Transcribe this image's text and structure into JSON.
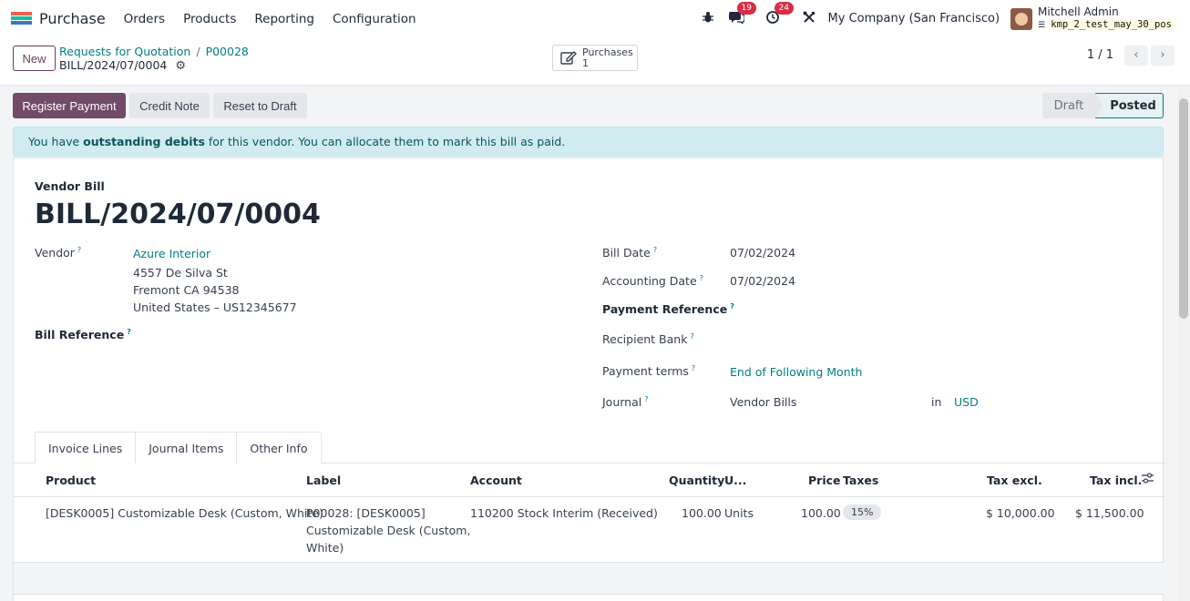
{
  "navbar": {
    "app_name": "Purchase",
    "menu": [
      "Orders",
      "Products",
      "Reporting",
      "Configuration"
    ],
    "messages_count": "19",
    "activities_count": "24",
    "company": "My Company (San Francisco)",
    "user_name": "Mitchell Admin",
    "db_name": "kmp_2_test_may_30_pos"
  },
  "control_panel": {
    "new_label": "New",
    "breadcrumb": [
      "Requests for Quotation",
      "P00028"
    ],
    "record_name": "BILL/2024/07/0004",
    "smart_button_label": "Purchases",
    "smart_button_count": "1",
    "pager": "1 / 1"
  },
  "actions": {
    "register_payment": "Register Payment",
    "credit_note": "Credit Note",
    "reset_to_draft": "Reset to Draft"
  },
  "status": {
    "draft": "Draft",
    "posted": "Posted",
    "active": "Posted"
  },
  "alert": {
    "prefix": "You have ",
    "bold": "outstanding debits",
    "suffix": " for this vendor. You can allocate them to mark this bill as paid."
  },
  "form": {
    "doc_type": "Vendor Bill",
    "doc_name": "BILL/2024/07/0004",
    "vendor_label": "Vendor",
    "vendor_name": "Azure Interior",
    "vendor_address": [
      "4557 De Silva St",
      "Fremont CA 94538",
      "United States – US12345677"
    ],
    "bill_reference_label": "Bill Reference",
    "bill_date_label": "Bill Date",
    "bill_date": "07/02/2024",
    "accounting_date_label": "Accounting Date",
    "accounting_date": "07/02/2024",
    "payment_reference_label": "Payment Reference",
    "recipient_bank_label": "Recipient Bank",
    "payment_terms_label": "Payment terms",
    "payment_terms": "End of Following Month",
    "journal_label": "Journal",
    "journal": "Vendor Bills",
    "in_label": "in",
    "currency": "USD"
  },
  "tabs": [
    "Invoice Lines",
    "Journal Items",
    "Other Info"
  ],
  "lines": {
    "headers": [
      "Product",
      "Label",
      "Account",
      "Quantity",
      "U...",
      "Price",
      "Taxes",
      "Tax excl.",
      "Tax incl."
    ],
    "rows": [
      {
        "product": "[DESK0005] Customizable Desk (Custom, White)",
        "label": [
          "P00028: [DESK0005]",
          "Customizable Desk (Custom,",
          "White)"
        ],
        "account": "110200 Stock Interim (Received)",
        "quantity": "100.00",
        "uom": "Units",
        "price": "100.00",
        "taxes": "15%",
        "tax_excl": "$ 10,000.00",
        "tax_incl": "$ 11,500.00"
      }
    ]
  },
  "colors": {
    "primary": "#714b67",
    "link": "#017e84",
    "alert_bg": "#d1ecf1"
  }
}
